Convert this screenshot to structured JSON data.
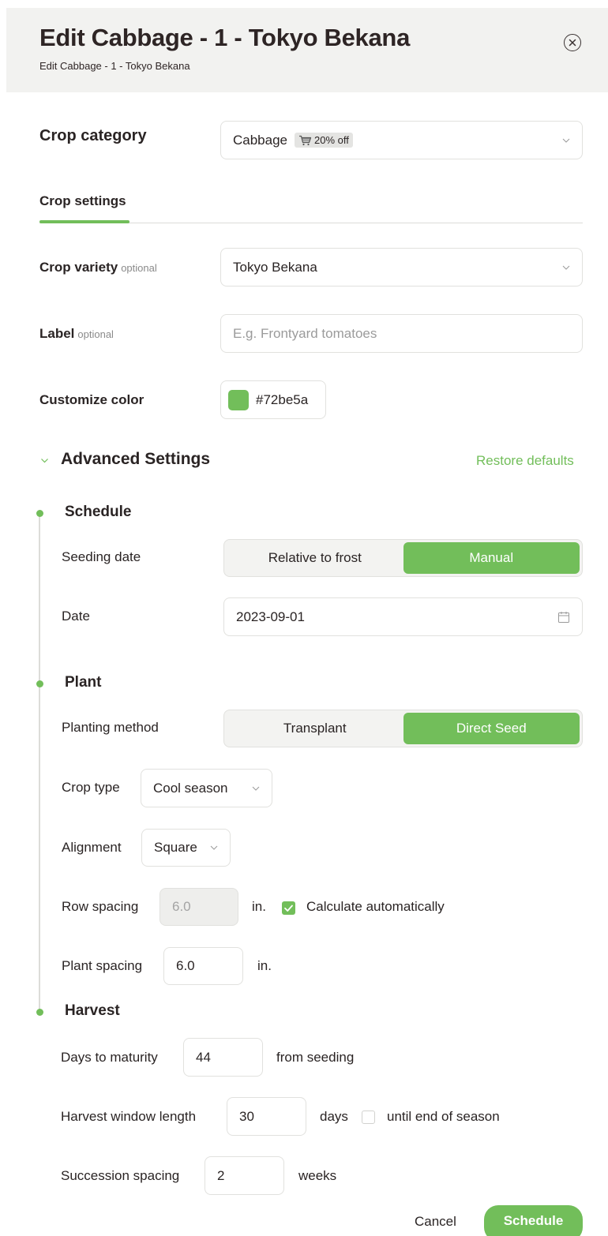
{
  "header": {
    "title": "Edit Cabbage - 1 - Tokyo Bekana",
    "subtitle": "Edit Cabbage - 1 - Tokyo Bekana",
    "close_icon": "close-circle-icon"
  },
  "crop_category": {
    "label": "Crop category",
    "value": "Cabbage",
    "badge": "20% off",
    "badge_icon": "cart-icon"
  },
  "tabs": [
    {
      "label": "Crop settings",
      "active": true
    }
  ],
  "crop_variety": {
    "label": "Crop variety",
    "optional": "optional",
    "value": "Tokyo Bekana"
  },
  "label_field": {
    "label": "Label",
    "optional": "optional",
    "placeholder": "E.g. Frontyard tomatoes",
    "value": ""
  },
  "customize_color": {
    "label": "Customize color",
    "value": "#72be5a"
  },
  "advanced": {
    "title": "Advanced Settings",
    "restore": "Restore defaults"
  },
  "schedule": {
    "title": "Schedule",
    "seeding_date": {
      "label": "Seeding date",
      "options": [
        "Relative to frost",
        "Manual"
      ],
      "selected": "Manual"
    },
    "date": {
      "label": "Date",
      "value": "2023-09-01"
    }
  },
  "plant": {
    "title": "Plant",
    "planting_method": {
      "label": "Planting method",
      "options": [
        "Transplant",
        "Direct Seed"
      ],
      "selected": "Direct Seed"
    },
    "crop_type": {
      "label": "Crop type",
      "value": "Cool season"
    },
    "alignment": {
      "label": "Alignment",
      "value": "Square"
    },
    "row_spacing": {
      "label": "Row spacing",
      "value": "6.0",
      "unit": "in.",
      "auto_label": "Calculate automatically",
      "auto_checked": true
    },
    "plant_spacing": {
      "label": "Plant spacing",
      "value": "6.0",
      "unit": "in."
    }
  },
  "harvest": {
    "title": "Harvest",
    "days_to_maturity": {
      "label": "Days to maturity",
      "value": "44",
      "suffix": "from seeding"
    },
    "harvest_window": {
      "label": "Harvest window length",
      "value": "30",
      "unit": "days",
      "eos_label": "until end of season",
      "eos_checked": false
    },
    "succession_spacing": {
      "label": "Succession spacing",
      "value": "2",
      "unit": "weeks"
    }
  },
  "footer": {
    "cancel": "Cancel",
    "schedule": "Schedule"
  },
  "colors": {
    "accent": "#72be5a",
    "header_bg": "#f2f2f0"
  }
}
